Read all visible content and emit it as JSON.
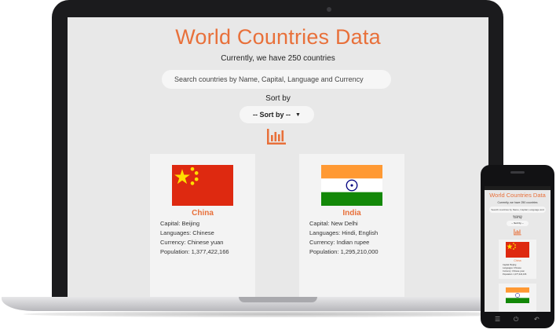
{
  "header": {
    "title": "World Countries Data",
    "subtitle": "Currently, we have 250 countries"
  },
  "search": {
    "placeholder": "Search countries by Name, Capital, Language and Currency"
  },
  "sort": {
    "label": "Sort by",
    "selected": "-- Sort by --"
  },
  "icons": {
    "chart": "bar-chart-icon",
    "color": "#e8703a"
  },
  "countries": [
    {
      "name": "China",
      "capital": "Capital: Beijing",
      "languages": "Languages: Chinese",
      "currency": "Currency: Chinese yuan",
      "population": "Population: 1,377,422,166"
    },
    {
      "name": "India",
      "capital": "Capital: New Delhi",
      "languages": "Languages: Hindi, English",
      "currency": "Currency: Indian rupee",
      "population": "Population: 1,295,210,000"
    }
  ],
  "phone": {
    "title": "World Countries Data",
    "subtitle": "Currently, we have 250 countries",
    "search_placeholder": "Search countries by Name, Capital, Language and Currency",
    "sort_label": "Sort by",
    "sort_selected": "-- Sort by --",
    "card_name": "China",
    "card_capital": "Capital: Beijing",
    "card_languages": "Languages: Chinese",
    "card_currency": "Currency: Chinese yuan",
    "card_population": "Population: 1,377,422,166"
  }
}
